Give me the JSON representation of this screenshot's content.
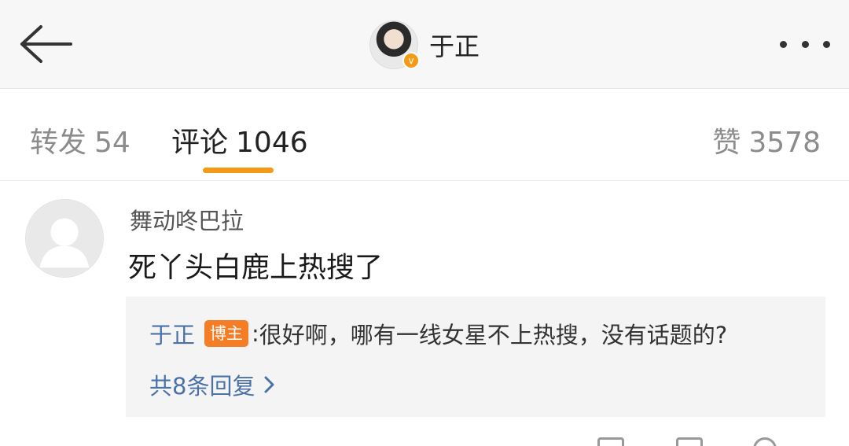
{
  "header": {
    "back_icon": "arrow-left-icon",
    "profile_name": "于正",
    "verified_icon": "verified-v-icon",
    "verified_glyph": "v",
    "more_icon": "more-dots-icon"
  },
  "tabs": {
    "repost": {
      "label": "转发",
      "count": "54"
    },
    "comment": {
      "label": "评论",
      "count": "1046"
    },
    "like": {
      "label": "赞",
      "count": "3578"
    },
    "active": "comment",
    "accent": "#f29a1a"
  },
  "comment": {
    "username": "舞动咚巴拉",
    "text": "死丫头白鹿上热搜了",
    "reply": {
      "author": "于正",
      "badge": "博主",
      "separator": ":",
      "text": "很好啊，哪有一线女星不上热搜，没有话题的?",
      "view_more": "共8条回复"
    }
  },
  "colors": {
    "link": "#4a72a8",
    "badge": "#f47d26",
    "header_bg": "#f7f7f7",
    "reply_bg": "#f4f4f4"
  }
}
